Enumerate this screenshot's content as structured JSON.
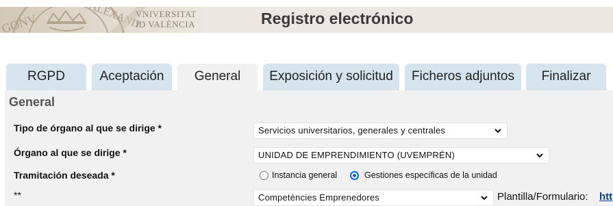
{
  "header": {
    "university_line1": "VNIVERSITAT",
    "university_line2": "ID VALÈNCIA",
    "seal_text": "GONVLITAS ALEXAND",
    "title": "Registro electrónico"
  },
  "tabs": [
    {
      "label": "RGPD",
      "active": false
    },
    {
      "label": "Aceptación",
      "active": false
    },
    {
      "label": "General",
      "active": true
    },
    {
      "label": "Exposición y solicitud",
      "active": false
    },
    {
      "label": "Ficheros adjuntos",
      "active": false
    },
    {
      "label": "Finalizar",
      "active": false
    }
  ],
  "general": {
    "section_title": "General",
    "organ_type": {
      "label": "Tipo de órgano al que se dirige *",
      "value": "Servicios universitarios, generales y centrales"
    },
    "organ": {
      "label": "Órgano al que se dirige *",
      "value": "UNIDAD DE EMPRENDIMIENTO (UVEMPRÉN)"
    },
    "procedure": {
      "label": "Tramitación deseada *",
      "options": [
        {
          "label": "Instancia general",
          "selected": false
        },
        {
          "label": "Gestiones específicas de la unidad",
          "selected": true
        }
      ]
    },
    "specific": {
      "label": "**",
      "value": "Competències Emprenedores",
      "template_label": "Plantilla/Formulario:",
      "template_link": "htt"
    }
  },
  "colors": {
    "tab_inactive": "#d6e4ee",
    "tab_active": "#f1f1f1",
    "panel": "#f1f1f1",
    "header_bg": "#ece8e1",
    "radio_accent": "#0a66d6",
    "link": "#0b3c8f"
  },
  "icons": {
    "dropdown": "chevron-down-icon",
    "seal": "university-seal-icon"
  }
}
